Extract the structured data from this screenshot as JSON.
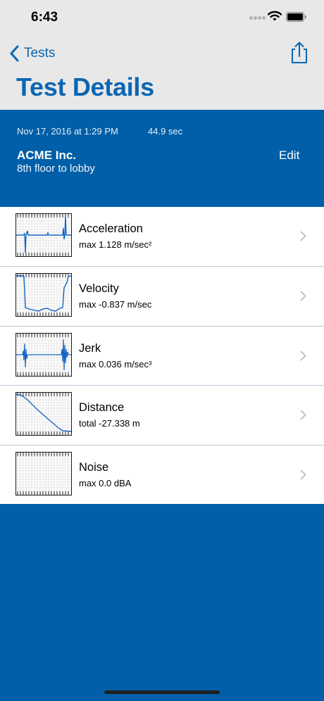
{
  "status_bar": {
    "time": "6:43"
  },
  "nav": {
    "back_label": "Tests",
    "title": "Test Details"
  },
  "header": {
    "date": "Nov 17, 2016 at 1:29 PM",
    "duration": "44.9 sec",
    "company": "ACME Inc.",
    "route": "8th floor to lobby",
    "edit_label": "Edit"
  },
  "metrics": [
    {
      "title": "Acceleration",
      "detail": "max 1.128 m/sec²"
    },
    {
      "title": "Velocity",
      "detail": "max -0.837 m/sec"
    },
    {
      "title": "Jerk",
      "detail": "max 0.036 m/sec³"
    },
    {
      "title": "Distance",
      "detail": "total -27.338 m"
    },
    {
      "title": "Noise",
      "detail": "max 0.0 dBA"
    }
  ],
  "colors": {
    "brand_blue": "#005FA8",
    "title_blue": "#0B66B2",
    "trace_blue": "#1565C0",
    "nav_background": "#E8E8E8"
  },
  "icons": {
    "back": "chevron-left-icon",
    "share": "share-icon",
    "disclosure": "chevron-right-icon"
  }
}
